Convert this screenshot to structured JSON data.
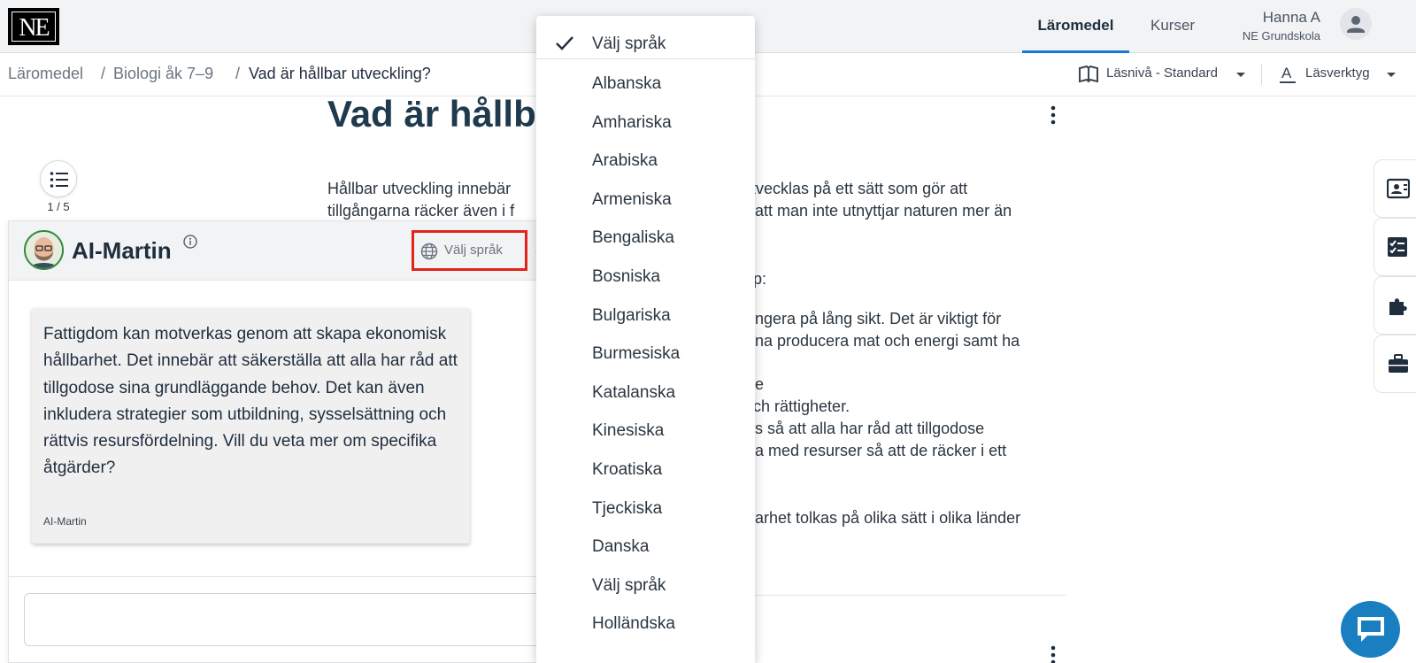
{
  "topbar": {
    "logo_text": "NE",
    "tabs": [
      {
        "label": "Läromedel",
        "active": true
      },
      {
        "label": "Kurser",
        "active": false
      }
    ],
    "user": {
      "name": "Hanna A",
      "school": "NE Grundskola"
    }
  },
  "breadcrumb": {
    "items": [
      "Läromedel",
      "Biologi åk 7–9",
      "Vad är hållbar utveckling?"
    ],
    "separator": "/"
  },
  "tools": {
    "reading_level": "Läsnivå - Standard",
    "reading_tools": "Läsverktyg"
  },
  "article": {
    "title_visible": "Vad är hållba",
    "lines": [
      {
        "text": "Hållbar utveckling innebär",
        "col": "left"
      },
      {
        "text": "utvecklas på ett sätt som gör att",
        "col": "right"
      },
      {
        "text": "tillgångarna räcker även i f",
        "col": "left"
      },
      {
        "text": "att man inte utnyttjar naturen mer än",
        "col": "right"
      },
      {
        "text": "p:",
        "col": "right"
      },
      {
        "text": "ngera på lång sikt. Det är viktigt för",
        "col": "right"
      },
      {
        "text": "na producera mat och energi samt ha",
        "col": "right"
      },
      {
        "text": "e",
        "col": "right"
      },
      {
        "text": "och rättigheter.",
        "col": "right"
      },
      {
        "text": "s så att alla har råd att tillgodose",
        "col": "right"
      },
      {
        "text": "a med resurser så att de räcker i ett",
        "col": "right"
      },
      {
        "text": "arhet tolkas på olika sätt i olika länder",
        "col": "right"
      }
    ]
  },
  "toc": {
    "count": "1 / 5"
  },
  "ai_panel": {
    "name": "AI-Martin",
    "language_button": "Välj språk",
    "message": "Fattigdom kan motverkas genom att skapa ekonomisk hållbarhet. Det innebär att säkerställa att alla har råd att tillgodose sina grundläggande behov. Det kan även inkludera strategier som utbildning, sysselsättning och rättvis resursfördelning. Vill du veta mer om specifika åtgärder?",
    "message_author": "AI-Martin",
    "input_value": ""
  },
  "language_dropdown": {
    "selected": "Välj språk",
    "options": [
      "Albanska",
      "Amhariska",
      "Arabiska",
      "Armeniska",
      "Bengaliska",
      "Bosniska",
      "Bulgariska",
      "Burmesiska",
      "Katalanska",
      "Kinesiska",
      "Kroatiska",
      "Tjeckiska",
      "Danska",
      "Välj språk",
      "Holländska"
    ]
  },
  "colors": {
    "accent": "#1976d2",
    "highlight_box": "#e2231a",
    "chat_fab": "#1a7fc1"
  }
}
